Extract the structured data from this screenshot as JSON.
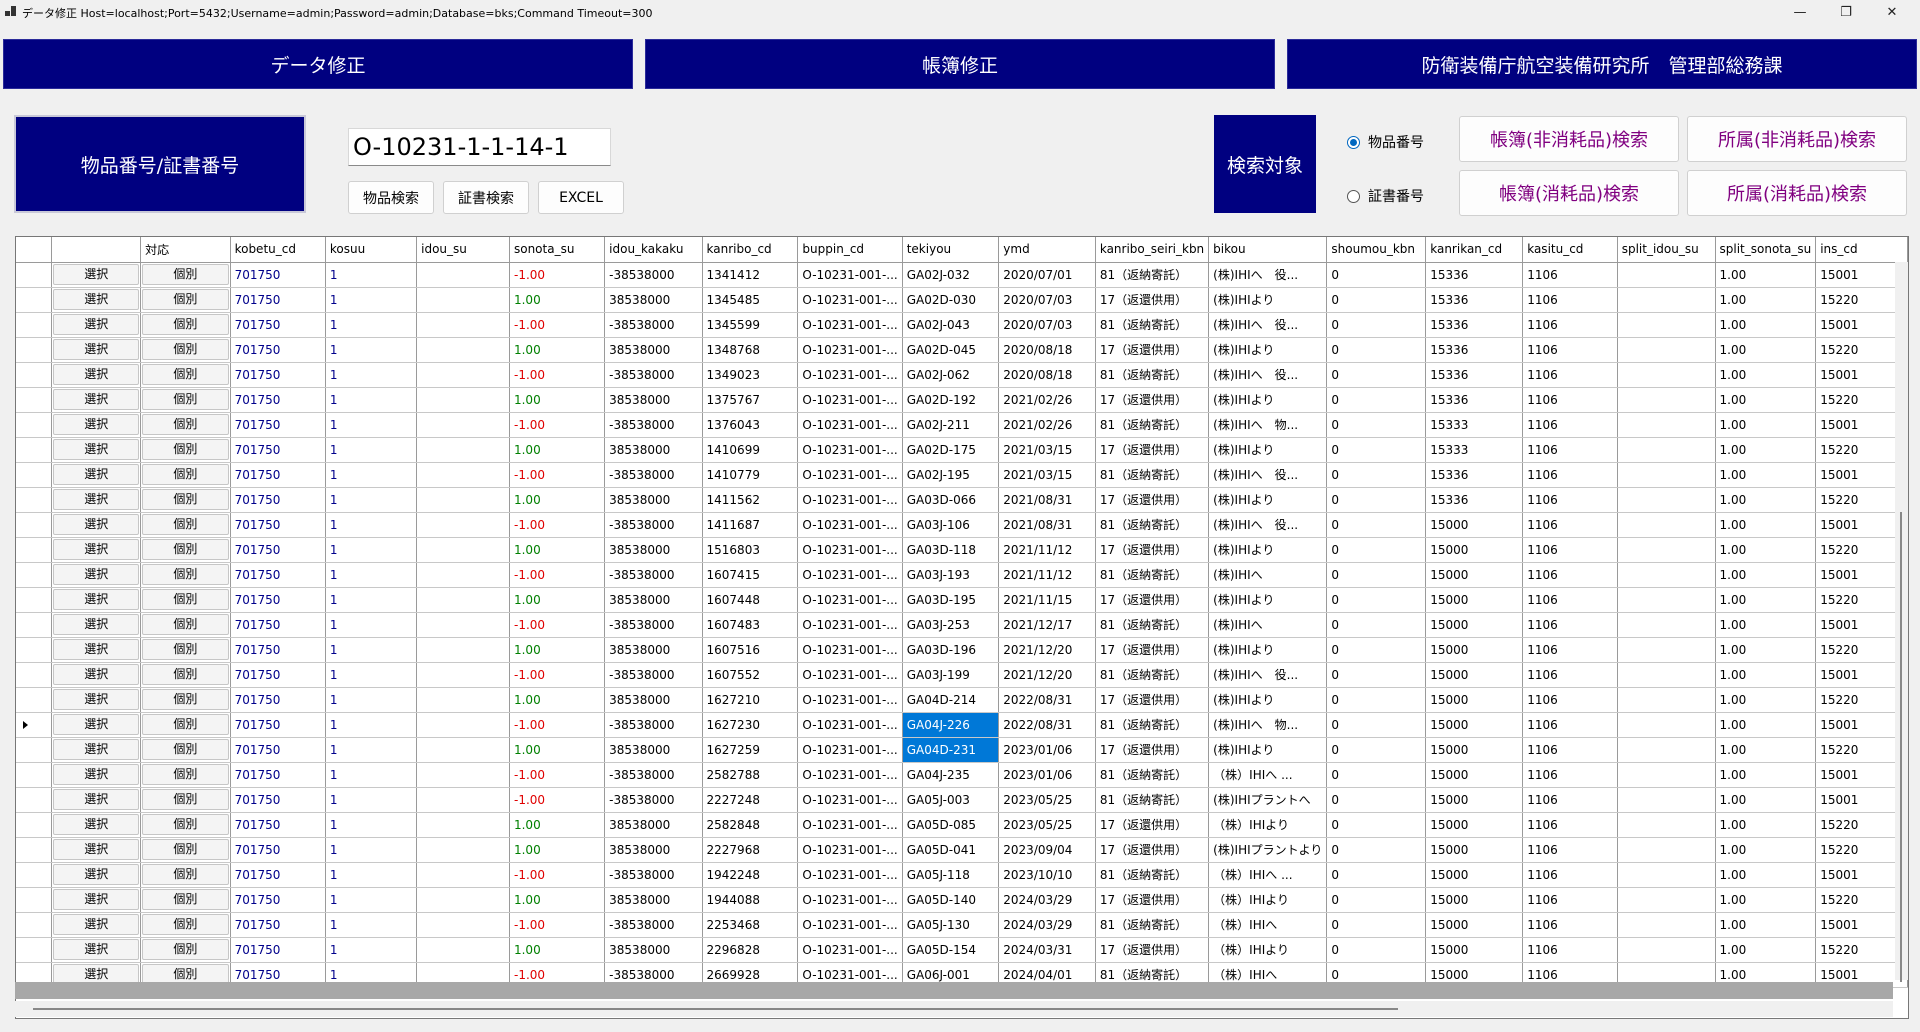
{
  "window": {
    "title": "データ修正 Host=localhost;Port=5432;Username=admin;Password=admin;Database=bks;Command Timeout=300",
    "min": "—",
    "max": "❐",
    "close": "✕"
  },
  "header": {
    "data_fix": "データ修正",
    "ledger_fix": "帳簿修正",
    "org": "防衛装備庁航空装備研究所　管理部総務課"
  },
  "search": {
    "label": "物品番号/証書番号",
    "value": "O-10231-1-1-14-1",
    "btn_item": "物品検索",
    "btn_cert": "証書検索",
    "btn_excel": "EXCEL",
    "target_label": "検索対象",
    "radio_item": "物品番号",
    "radio_cert": "証書番号",
    "radio_selected": "item",
    "btn_ledger_nonconsumable": "帳簿(非消耗品)検索",
    "btn_affil_nonconsumable": "所属(非消耗品)検索",
    "btn_ledger_consumable": "帳簿(消耗品)検索",
    "btn_affil_consumable": "所属(消耗品)検索"
  },
  "grid": {
    "columns": [
      "",
      "対応",
      "kobetu_cd",
      "kosuu",
      "idou_su",
      "sonota_su",
      "idou_kakaku",
      "kanribo_cd",
      "buppin_cd",
      "tekiyou",
      "ymd",
      "kanribo_seiri_kbn",
      "bikou",
      "shoumou_kbn",
      "kanrikan_cd",
      "kasitu_cd",
      "split_idou_su",
      "split_sonota_su",
      "ins_cd"
    ],
    "select_label": "選択",
    "kobetsu_label": "個別",
    "current_row": 18,
    "selected_cells": [
      [
        18,
        "tekiyou"
      ],
      [
        19,
        "tekiyou"
      ]
    ],
    "rows": [
      {
        "kobetu_cd": "701750",
        "kosuu": "1",
        "idou_su": "",
        "sonota_su": "-1.00",
        "idou_kakaku": "-38538000",
        "kanribo_cd": "1341412",
        "buppin_cd": "O-10231-001-...",
        "tekiyou": "GA02J-032",
        "ymd": "2020/07/01",
        "kanribo_seiri_kbn": "81（返納寄託）",
        "bikou": "(株)IHIへ　役...",
        "shoumou_kbn": "0",
        "kanrikan_cd": "15336",
        "kasitu_cd": "1106",
        "split_idou_su": "",
        "split_sonota_su": "1.00",
        "ins_cd": "15001"
      },
      {
        "kobetu_cd": "701750",
        "kosuu": "1",
        "idou_su": "",
        "sonota_su": "1.00",
        "idou_kakaku": "38538000",
        "kanribo_cd": "1345485",
        "buppin_cd": "O-10231-001-...",
        "tekiyou": "GA02D-030",
        "ymd": "2020/07/03",
        "kanribo_seiri_kbn": "17（返還供用）",
        "bikou": "(株)IHIより",
        "shoumou_kbn": "0",
        "kanrikan_cd": "15336",
        "kasitu_cd": "1106",
        "split_idou_su": "",
        "split_sonota_su": "1.00",
        "ins_cd": "15220"
      },
      {
        "kobetu_cd": "701750",
        "kosuu": "1",
        "idou_su": "",
        "sonota_su": "-1.00",
        "idou_kakaku": "-38538000",
        "kanribo_cd": "1345599",
        "buppin_cd": "O-10231-001-...",
        "tekiyou": "GA02J-043",
        "ymd": "2020/07/03",
        "kanribo_seiri_kbn": "81（返納寄託）",
        "bikou": "(株)IHIへ　役...",
        "shoumou_kbn": "0",
        "kanrikan_cd": "15336",
        "kasitu_cd": "1106",
        "split_idou_su": "",
        "split_sonota_su": "1.00",
        "ins_cd": "15001"
      },
      {
        "kobetu_cd": "701750",
        "kosuu": "1",
        "idou_su": "",
        "sonota_su": "1.00",
        "idou_kakaku": "38538000",
        "kanribo_cd": "1348768",
        "buppin_cd": "O-10231-001-...",
        "tekiyou": "GA02D-045",
        "ymd": "2020/08/18",
        "kanribo_seiri_kbn": "17（返還供用）",
        "bikou": "(株)IHIより",
        "shoumou_kbn": "0",
        "kanrikan_cd": "15336",
        "kasitu_cd": "1106",
        "split_idou_su": "",
        "split_sonota_su": "1.00",
        "ins_cd": "15220"
      },
      {
        "kobetu_cd": "701750",
        "kosuu": "1",
        "idou_su": "",
        "sonota_su": "-1.00",
        "idou_kakaku": "-38538000",
        "kanribo_cd": "1349023",
        "buppin_cd": "O-10231-001-...",
        "tekiyou": "GA02J-062",
        "ymd": "2020/08/18",
        "kanribo_seiri_kbn": "81（返納寄託）",
        "bikou": "(株)IHIへ　役...",
        "shoumou_kbn": "0",
        "kanrikan_cd": "15336",
        "kasitu_cd": "1106",
        "split_idou_su": "",
        "split_sonota_su": "1.00",
        "ins_cd": "15001"
      },
      {
        "kobetu_cd": "701750",
        "kosuu": "1",
        "idou_su": "",
        "sonota_su": "1.00",
        "idou_kakaku": "38538000",
        "kanribo_cd": "1375767",
        "buppin_cd": "O-10231-001-...",
        "tekiyou": "GA02D-192",
        "ymd": "2021/02/26",
        "kanribo_seiri_kbn": "17（返還供用）",
        "bikou": "(株)IHIより",
        "shoumou_kbn": "0",
        "kanrikan_cd": "15336",
        "kasitu_cd": "1106",
        "split_idou_su": "",
        "split_sonota_su": "1.00",
        "ins_cd": "15220"
      },
      {
        "kobetu_cd": "701750",
        "kosuu": "1",
        "idou_su": "",
        "sonota_su": "-1.00",
        "idou_kakaku": "-38538000",
        "kanribo_cd": "1376043",
        "buppin_cd": "O-10231-001-...",
        "tekiyou": "GA02J-211",
        "ymd": "2021/02/26",
        "kanribo_seiri_kbn": "81（返納寄託）",
        "bikou": "(株)IHIへ　物...",
        "shoumou_kbn": "0",
        "kanrikan_cd": "15333",
        "kasitu_cd": "1106",
        "split_idou_su": "",
        "split_sonota_su": "1.00",
        "ins_cd": "15001"
      },
      {
        "kobetu_cd": "701750",
        "kosuu": "1",
        "idou_su": "",
        "sonota_su": "1.00",
        "idou_kakaku": "38538000",
        "kanribo_cd": "1410699",
        "buppin_cd": "O-10231-001-...",
        "tekiyou": "GA02D-175",
        "ymd": "2021/03/15",
        "kanribo_seiri_kbn": "17（返還供用）",
        "bikou": "(株)IHIより",
        "shoumou_kbn": "0",
        "kanrikan_cd": "15333",
        "kasitu_cd": "1106",
        "split_idou_su": "",
        "split_sonota_su": "1.00",
        "ins_cd": "15220"
      },
      {
        "kobetu_cd": "701750",
        "kosuu": "1",
        "idou_su": "",
        "sonota_su": "-1.00",
        "idou_kakaku": "-38538000",
        "kanribo_cd": "1410779",
        "buppin_cd": "O-10231-001-...",
        "tekiyou": "GA02J-195",
        "ymd": "2021/03/15",
        "kanribo_seiri_kbn": "81（返納寄託）",
        "bikou": "(株)IHIへ　役...",
        "shoumou_kbn": "0",
        "kanrikan_cd": "15336",
        "kasitu_cd": "1106",
        "split_idou_su": "",
        "split_sonota_su": "1.00",
        "ins_cd": "15001"
      },
      {
        "kobetu_cd": "701750",
        "kosuu": "1",
        "idou_su": "",
        "sonota_su": "1.00",
        "idou_kakaku": "38538000",
        "kanribo_cd": "1411562",
        "buppin_cd": "O-10231-001-...",
        "tekiyou": "GA03D-066",
        "ymd": "2021/08/31",
        "kanribo_seiri_kbn": "17（返還供用）",
        "bikou": "(株)IHIより",
        "shoumou_kbn": "0",
        "kanrikan_cd": "15336",
        "kasitu_cd": "1106",
        "split_idou_su": "",
        "split_sonota_su": "1.00",
        "ins_cd": "15220"
      },
      {
        "kobetu_cd": "701750",
        "kosuu": "1",
        "idou_su": "",
        "sonota_su": "-1.00",
        "idou_kakaku": "-38538000",
        "kanribo_cd": "1411687",
        "buppin_cd": "O-10231-001-...",
        "tekiyou": "GA03J-106",
        "ymd": "2021/08/31",
        "kanribo_seiri_kbn": "81（返納寄託）",
        "bikou": "(株)IHIへ　役...",
        "shoumou_kbn": "0",
        "kanrikan_cd": "15000",
        "kasitu_cd": "1106",
        "split_idou_su": "",
        "split_sonota_su": "1.00",
        "ins_cd": "15001"
      },
      {
        "kobetu_cd": "701750",
        "kosuu": "1",
        "idou_su": "",
        "sonota_su": "1.00",
        "idou_kakaku": "38538000",
        "kanribo_cd": "1516803",
        "buppin_cd": "O-10231-001-...",
        "tekiyou": "GA03D-118",
        "ymd": "2021/11/12",
        "kanribo_seiri_kbn": "17（返還供用）",
        "bikou": "(株)IHIより",
        "shoumou_kbn": "0",
        "kanrikan_cd": "15000",
        "kasitu_cd": "1106",
        "split_idou_su": "",
        "split_sonota_su": "1.00",
        "ins_cd": "15220"
      },
      {
        "kobetu_cd": "701750",
        "kosuu": "1",
        "idou_su": "",
        "sonota_su": "-1.00",
        "idou_kakaku": "-38538000",
        "kanribo_cd": "1607415",
        "buppin_cd": "O-10231-001-...",
        "tekiyou": "GA03J-193",
        "ymd": "2021/11/12",
        "kanribo_seiri_kbn": "81（返納寄託）",
        "bikou": "(株)IHIへ",
        "shoumou_kbn": "0",
        "kanrikan_cd": "15000",
        "kasitu_cd": "1106",
        "split_idou_su": "",
        "split_sonota_su": "1.00",
        "ins_cd": "15001"
      },
      {
        "kobetu_cd": "701750",
        "kosuu": "1",
        "idou_su": "",
        "sonota_su": "1.00",
        "idou_kakaku": "38538000",
        "kanribo_cd": "1607448",
        "buppin_cd": "O-10231-001-...",
        "tekiyou": "GA03D-195",
        "ymd": "2021/11/15",
        "kanribo_seiri_kbn": "17（返還供用）",
        "bikou": "(株)IHIより",
        "shoumou_kbn": "0",
        "kanrikan_cd": "15000",
        "kasitu_cd": "1106",
        "split_idou_su": "",
        "split_sonota_su": "1.00",
        "ins_cd": "15220"
      },
      {
        "kobetu_cd": "701750",
        "kosuu": "1",
        "idou_su": "",
        "sonota_su": "-1.00",
        "idou_kakaku": "-38538000",
        "kanribo_cd": "1607483",
        "buppin_cd": "O-10231-001-...",
        "tekiyou": "GA03J-253",
        "ymd": "2021/12/17",
        "kanribo_seiri_kbn": "81（返納寄託）",
        "bikou": "(株)IHIへ",
        "shoumou_kbn": "0",
        "kanrikan_cd": "15000",
        "kasitu_cd": "1106",
        "split_idou_su": "",
        "split_sonota_su": "1.00",
        "ins_cd": "15001"
      },
      {
        "kobetu_cd": "701750",
        "kosuu": "1",
        "idou_su": "",
        "sonota_su": "1.00",
        "idou_kakaku": "38538000",
        "kanribo_cd": "1607516",
        "buppin_cd": "O-10231-001-...",
        "tekiyou": "GA03D-196",
        "ymd": "2021/12/20",
        "kanribo_seiri_kbn": "17（返還供用）",
        "bikou": "(株)IHIより",
        "shoumou_kbn": "0",
        "kanrikan_cd": "15000",
        "kasitu_cd": "1106",
        "split_idou_su": "",
        "split_sonota_su": "1.00",
        "ins_cd": "15220"
      },
      {
        "kobetu_cd": "701750",
        "kosuu": "1",
        "idou_su": "",
        "sonota_su": "-1.00",
        "idou_kakaku": "-38538000",
        "kanribo_cd": "1607552",
        "buppin_cd": "O-10231-001-...",
        "tekiyou": "GA03J-199",
        "ymd": "2021/12/20",
        "kanribo_seiri_kbn": "81（返納寄託）",
        "bikou": "(株)IHIへ　役...",
        "shoumou_kbn": "0",
        "kanrikan_cd": "15000",
        "kasitu_cd": "1106",
        "split_idou_su": "",
        "split_sonota_su": "1.00",
        "ins_cd": "15001"
      },
      {
        "kobetu_cd": "701750",
        "kosuu": "1",
        "idou_su": "",
        "sonota_su": "1.00",
        "idou_kakaku": "38538000",
        "kanribo_cd": "1627210",
        "buppin_cd": "O-10231-001-...",
        "tekiyou": "GA04D-214",
        "ymd": "2022/08/31",
        "kanribo_seiri_kbn": "17（返還供用）",
        "bikou": "(株)IHIより",
        "shoumou_kbn": "0",
        "kanrikan_cd": "15000",
        "kasitu_cd": "1106",
        "split_idou_su": "",
        "split_sonota_su": "1.00",
        "ins_cd": "15220"
      },
      {
        "kobetu_cd": "701750",
        "kosuu": "1",
        "idou_su": "",
        "sonota_su": "-1.00",
        "idou_kakaku": "-38538000",
        "kanribo_cd": "1627230",
        "buppin_cd": "O-10231-001-...",
        "tekiyou": "GA04J-226",
        "ymd": "2022/08/31",
        "kanribo_seiri_kbn": "81（返納寄託）",
        "bikou": "(株)IHIへ　物...",
        "shoumou_kbn": "0",
        "kanrikan_cd": "15000",
        "kasitu_cd": "1106",
        "split_idou_su": "",
        "split_sonota_su": "1.00",
        "ins_cd": "15001"
      },
      {
        "kobetu_cd": "701750",
        "kosuu": "1",
        "idou_su": "",
        "sonota_su": "1.00",
        "idou_kakaku": "38538000",
        "kanribo_cd": "1627259",
        "buppin_cd": "O-10231-001-...",
        "tekiyou": "GA04D-231",
        "ymd": "2023/01/06",
        "kanribo_seiri_kbn": "17（返還供用）",
        "bikou": "(株)IHIより",
        "shoumou_kbn": "0",
        "kanrikan_cd": "15000",
        "kasitu_cd": "1106",
        "split_idou_su": "",
        "split_sonota_su": "1.00",
        "ins_cd": "15220"
      },
      {
        "kobetu_cd": "701750",
        "kosuu": "1",
        "idou_su": "",
        "sonota_su": "-1.00",
        "idou_kakaku": "-38538000",
        "kanribo_cd": "2582788",
        "buppin_cd": "O-10231-001-...",
        "tekiyou": "GA04J-235",
        "ymd": "2023/01/06",
        "kanribo_seiri_kbn": "81（返納寄託）",
        "bikou": "（株）IHIへ ...",
        "shoumou_kbn": "0",
        "kanrikan_cd": "15000",
        "kasitu_cd": "1106",
        "split_idou_su": "",
        "split_sonota_su": "1.00",
        "ins_cd": "15001"
      },
      {
        "kobetu_cd": "701750",
        "kosuu": "1",
        "idou_su": "",
        "sonota_su": "-1.00",
        "idou_kakaku": "-38538000",
        "kanribo_cd": "2227248",
        "buppin_cd": "O-10231-001-...",
        "tekiyou": "GA05J-003",
        "ymd": "2023/05/25",
        "kanribo_seiri_kbn": "81（返納寄託）",
        "bikou": "(株)IHIプラントへ",
        "shoumou_kbn": "0",
        "kanrikan_cd": "15000",
        "kasitu_cd": "1106",
        "split_idou_su": "",
        "split_sonota_su": "1.00",
        "ins_cd": "15001"
      },
      {
        "kobetu_cd": "701750",
        "kosuu": "1",
        "idou_su": "",
        "sonota_su": "1.00",
        "idou_kakaku": "38538000",
        "kanribo_cd": "2582848",
        "buppin_cd": "O-10231-001-...",
        "tekiyou": "GA05D-085",
        "ymd": "2023/05/25",
        "kanribo_seiri_kbn": "17（返還供用）",
        "bikou": "（株）IHIより",
        "shoumou_kbn": "0",
        "kanrikan_cd": "15000",
        "kasitu_cd": "1106",
        "split_idou_su": "",
        "split_sonota_su": "1.00",
        "ins_cd": "15220"
      },
      {
        "kobetu_cd": "701750",
        "kosuu": "1",
        "idou_su": "",
        "sonota_su": "1.00",
        "idou_kakaku": "38538000",
        "kanribo_cd": "2227968",
        "buppin_cd": "O-10231-001-...",
        "tekiyou": "GA05D-041",
        "ymd": "2023/09/04",
        "kanribo_seiri_kbn": "17（返還供用）",
        "bikou": "(株)IHIプラントより",
        "shoumou_kbn": "0",
        "kanrikan_cd": "15000",
        "kasitu_cd": "1106",
        "split_idou_su": "",
        "split_sonota_su": "1.00",
        "ins_cd": "15220"
      },
      {
        "kobetu_cd": "701750",
        "kosuu": "1",
        "idou_su": "",
        "sonota_su": "-1.00",
        "idou_kakaku": "-38538000",
        "kanribo_cd": "1942248",
        "buppin_cd": "O-10231-001-...",
        "tekiyou": "GA05J-118",
        "ymd": "2023/10/10",
        "kanribo_seiri_kbn": "81（返納寄託）",
        "bikou": "（株）IHIへ ...",
        "shoumou_kbn": "0",
        "kanrikan_cd": "15000",
        "kasitu_cd": "1106",
        "split_idou_su": "",
        "split_sonota_su": "1.00",
        "ins_cd": "15001"
      },
      {
        "kobetu_cd": "701750",
        "kosuu": "1",
        "idou_su": "",
        "sonota_su": "1.00",
        "idou_kakaku": "38538000",
        "kanribo_cd": "1944088",
        "buppin_cd": "O-10231-001-...",
        "tekiyou": "GA05D-140",
        "ymd": "2024/03/29",
        "kanribo_seiri_kbn": "17（返還供用）",
        "bikou": "（株）IHIより",
        "shoumou_kbn": "0",
        "kanrikan_cd": "15000",
        "kasitu_cd": "1106",
        "split_idou_su": "",
        "split_sonota_su": "1.00",
        "ins_cd": "15220"
      },
      {
        "kobetu_cd": "701750",
        "kosuu": "1",
        "idou_su": "",
        "sonota_su": "-1.00",
        "idou_kakaku": "-38538000",
        "kanribo_cd": "2253468",
        "buppin_cd": "O-10231-001-...",
        "tekiyou": "GA05J-130",
        "ymd": "2024/03/29",
        "kanribo_seiri_kbn": "81（返納寄託）",
        "bikou": "（株）IHIへ",
        "shoumou_kbn": "0",
        "kanrikan_cd": "15000",
        "kasitu_cd": "1106",
        "split_idou_su": "",
        "split_sonota_su": "1.00",
        "ins_cd": "15001"
      },
      {
        "kobetu_cd": "701750",
        "kosuu": "1",
        "idou_su": "",
        "sonota_su": "1.00",
        "idou_kakaku": "38538000",
        "kanribo_cd": "2296828",
        "buppin_cd": "O-10231-001-...",
        "tekiyou": "GA05D-154",
        "ymd": "2024/03/31",
        "kanribo_seiri_kbn": "17（返還供用）",
        "bikou": "（株）IHIより",
        "shoumou_kbn": "0",
        "kanrikan_cd": "15000",
        "kasitu_cd": "1106",
        "split_idou_su": "",
        "split_sonota_su": "1.00",
        "ins_cd": "15220"
      },
      {
        "kobetu_cd": "701750",
        "kosuu": "1",
        "idou_su": "",
        "sonota_su": "-1.00",
        "idou_kakaku": "-38538000",
        "kanribo_cd": "2669928",
        "buppin_cd": "O-10231-001-...",
        "tekiyou": "GA06J-001",
        "ymd": "2024/04/01",
        "kanribo_seiri_kbn": "81（返納寄託）",
        "bikou": "（株）IHIへ",
        "shoumou_kbn": "0",
        "kanrikan_cd": "15000",
        "kasitu_cd": "1106",
        "split_idou_su": "",
        "split_sonota_su": "1.00",
        "ins_cd": "15001"
      }
    ]
  }
}
